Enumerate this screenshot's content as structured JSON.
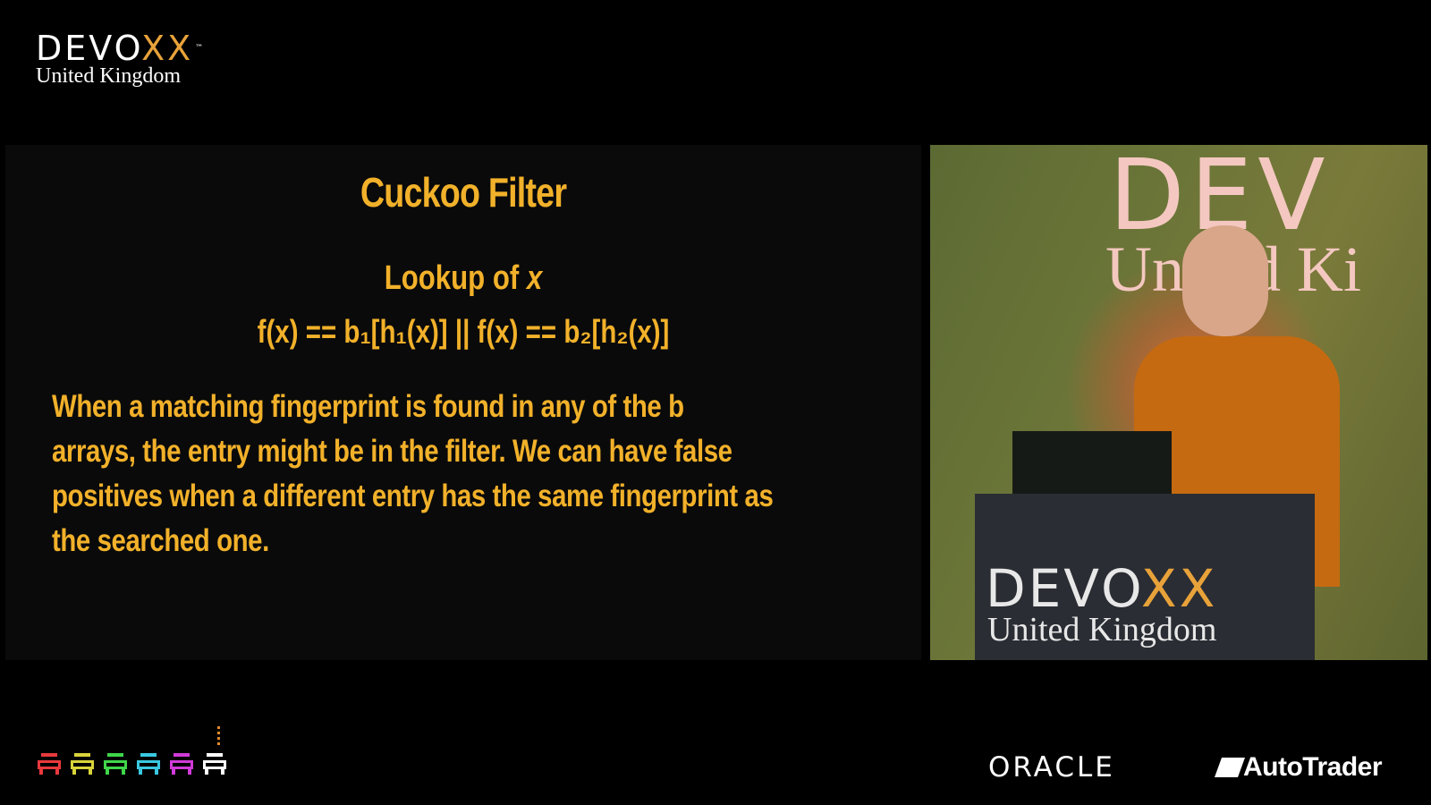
{
  "logo_top": {
    "word": "DEVO",
    "word_accent": "XX",
    "tm": "™",
    "sub": "United Kingdom"
  },
  "slide": {
    "title": "Cuckoo Filter",
    "subtitle_prefix": "Lookup of",
    "subtitle_var": "x",
    "formula": "f(x) == b₁[h₁(x)]  ||  f(x) == b₂[h₂(x)]",
    "body": "When a matching fingerprint is found in any of the b arrays, the entry might  be in the filter. We can have false positives when a different entry has the same fingerprint as the searched one.",
    "text_color": "#f2b12a"
  },
  "camera": {
    "wall_word": "DEV",
    "wall_sub": "United Ki",
    "podium_word": "DEVO",
    "podium_accent": "XX",
    "podium_sub": "United Kingdom"
  },
  "sponsors": {
    "oracle": "ORACLE",
    "autotrader": "AutoTrader"
  },
  "invader_colors": [
    "#e8393d",
    "#d9d43a",
    "#3fd64a",
    "#3ac8e0",
    "#d03ad8",
    "#ffffff"
  ]
}
